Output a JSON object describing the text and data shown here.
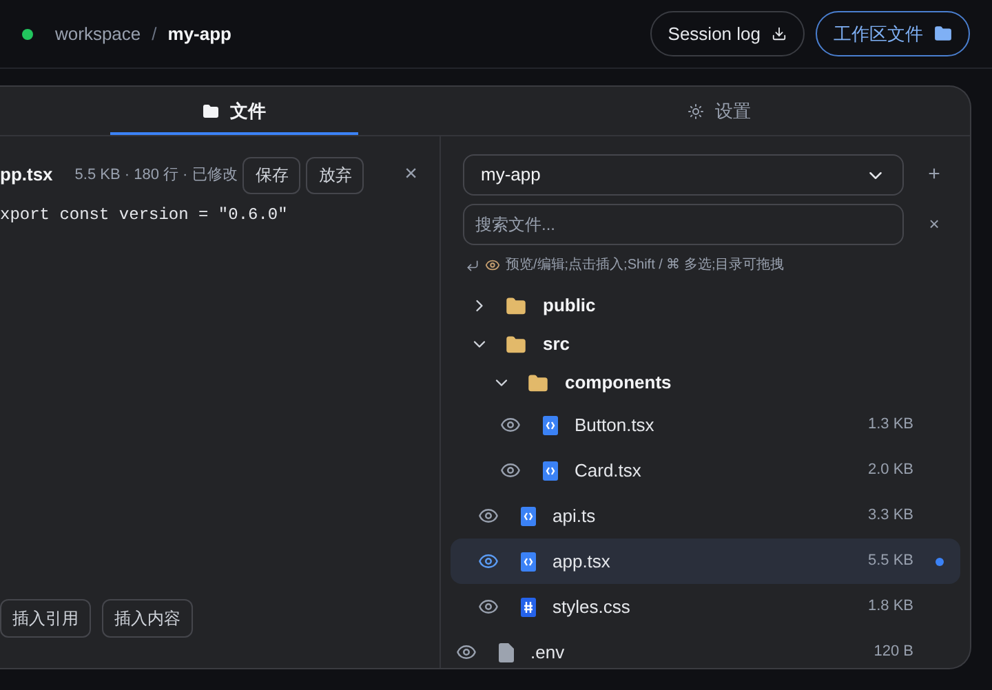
{
  "header": {
    "connected": true,
    "breadcrumb": [
      {
        "label": "workspace",
        "current": false
      },
      {
        "label": "my-app",
        "current": true
      }
    ],
    "separator": "/",
    "session_log": "Session log",
    "workspace_files": "工作区文件"
  },
  "tabs": [
    {
      "label": "文件",
      "selected": true,
      "kind": "folder"
    },
    {
      "label": "设置",
      "selected": false,
      "kind": "settings"
    }
  ],
  "editor": {
    "filename": "pp.tsx",
    "meta": "5.5 KB · 180 行 · 已修改",
    "save": "保存",
    "discard": "放弃",
    "close": "×",
    "code": "xport const version = \"0.6.0\"",
    "actions": [
      "插入引用",
      "插入内容"
    ]
  },
  "files": {
    "project": "my-app",
    "add": "+",
    "search_placeholder": "搜索文件...",
    "clear": "×",
    "hint": "预览/编辑;点击插入;Shift / ⌘ 多选;目录可拖拽",
    "tree": [
      {
        "kind": "folder",
        "name": "public",
        "expanded": false
      },
      {
        "kind": "folder",
        "name": "src",
        "expanded": true,
        "children": [
          {
            "kind": "folder",
            "name": "components",
            "expanded": true,
            "children": [
              {
                "kind": "code",
                "name": "Button.tsx",
                "size": "1.3 KB",
                "selected": false,
                "modified": false
              },
              {
                "kind": "code",
                "name": "Card.tsx",
                "size": "2.0 KB",
                "selected": false,
                "modified": false
              }
            ]
          },
          {
            "kind": "code",
            "name": "api.ts",
            "size": "3.3 KB",
            "selected": false,
            "modified": false
          },
          {
            "kind": "code",
            "name": "app.tsx",
            "size": "5.5 KB",
            "selected": true,
            "modified": true
          },
          {
            "kind": "style",
            "name": "styles.css",
            "size": "1.8 KB",
            "selected": false,
            "modified": false
          }
        ]
      },
      {
        "kind": "plain",
        "name": ".env",
        "size": "120 B",
        "selected": false,
        "modified": false
      }
    ]
  }
}
